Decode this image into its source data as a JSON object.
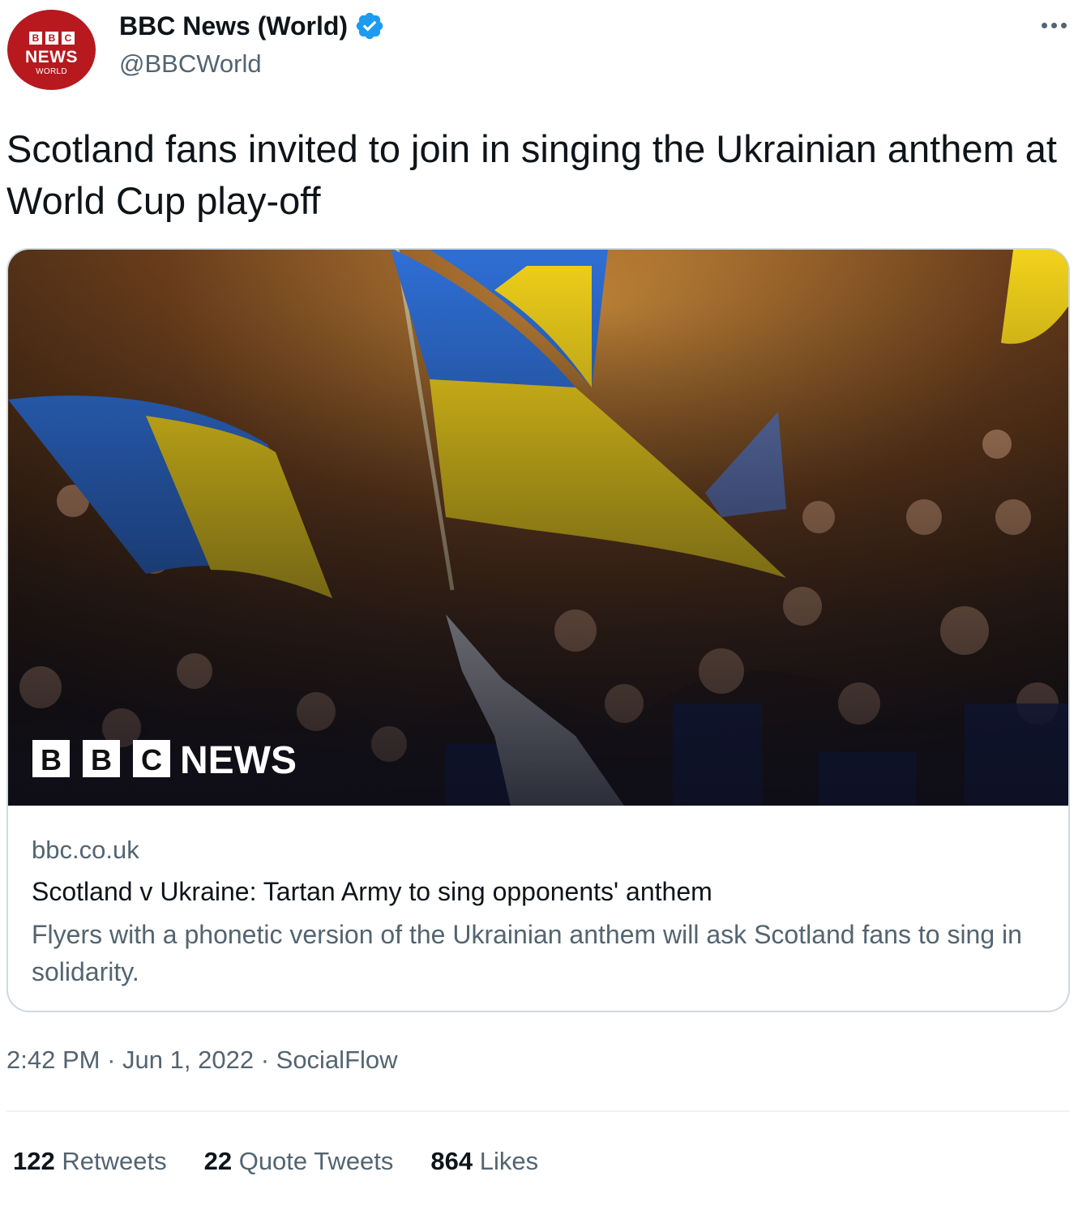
{
  "author": {
    "avatar": {
      "bbc_letters": [
        "B",
        "B",
        "C"
      ],
      "news_label": "NEWS",
      "world_label": "WORLD",
      "background": "#b7191f"
    },
    "display_name": "BBC News (World)",
    "verified_icon": "verified-badge-icon",
    "verified_color": "#1d9bf0",
    "handle": "@BBCWorld"
  },
  "more_icon": "more-options-icon",
  "tweet_text": "Scotland fans invited to join in singing the Ukrainian anthem at World Cup play-off",
  "card": {
    "image_description": "Football crowd waving Ukrainian flags",
    "image_watermark": {
      "letters": [
        "B",
        "B",
        "C"
      ],
      "word": "NEWS"
    },
    "domain": "bbc.co.uk",
    "title": "Scotland v Ukraine: Tartan Army to sing opponents' anthem",
    "description": "Flyers with a phonetic version of the Ukrainian anthem will ask Scotland fans to sing in solidarity."
  },
  "meta": {
    "time": "2:42 PM",
    "separator": "·",
    "date": "Jun 1, 2022",
    "source": "SocialFlow"
  },
  "stats": {
    "retweets": {
      "count": "122",
      "label": "Retweets"
    },
    "quote_tweets": {
      "count": "22",
      "label": "Quote Tweets"
    },
    "likes": {
      "count": "864",
      "label": "Likes"
    }
  },
  "colors": {
    "text_primary": "#0f1419",
    "text_secondary": "#536471",
    "border": "#cfd9de",
    "flag_blue": "#2f6fd6",
    "flag_yellow": "#f2d21b"
  }
}
